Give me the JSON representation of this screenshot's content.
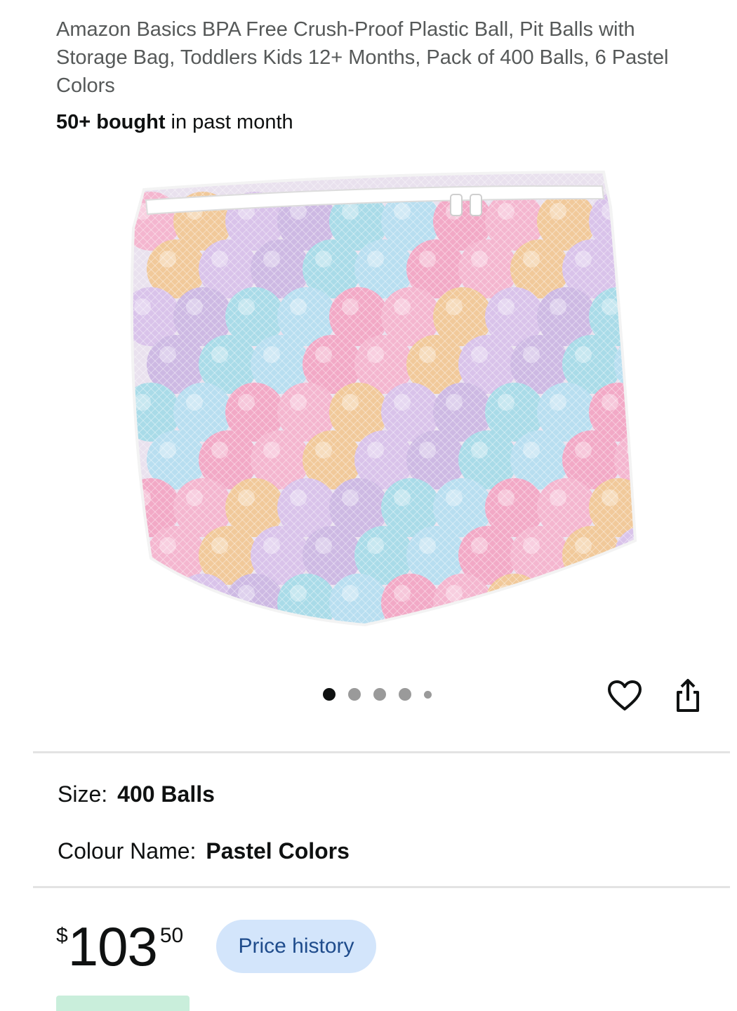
{
  "product": {
    "title": "Amazon Basics BPA Free Crush-Proof Plastic Ball, Pit Balls with Storage Bag, Toddlers Kids 12+ Months, Pack of 400 Balls, 6 Pastel Colors",
    "bought_bold": "50+ bought",
    "bought_rest": " in past month"
  },
  "gallery": {
    "image_count": 5,
    "active_index": 0,
    "fav_icon": "heart-icon",
    "share_icon": "share-icon"
  },
  "options": {
    "size_label": "Size:",
    "size_value": "400 Balls",
    "colour_label": "Colour Name:",
    "colour_value": "Pastel Colors"
  },
  "price": {
    "symbol": "$",
    "whole": "103",
    "fraction": "50",
    "history_button": "Price history"
  },
  "colors": {
    "price_history_bg": "#d3e5fb",
    "price_history_text": "#1f4c8c",
    "deal_strip": "#c9eedb"
  }
}
